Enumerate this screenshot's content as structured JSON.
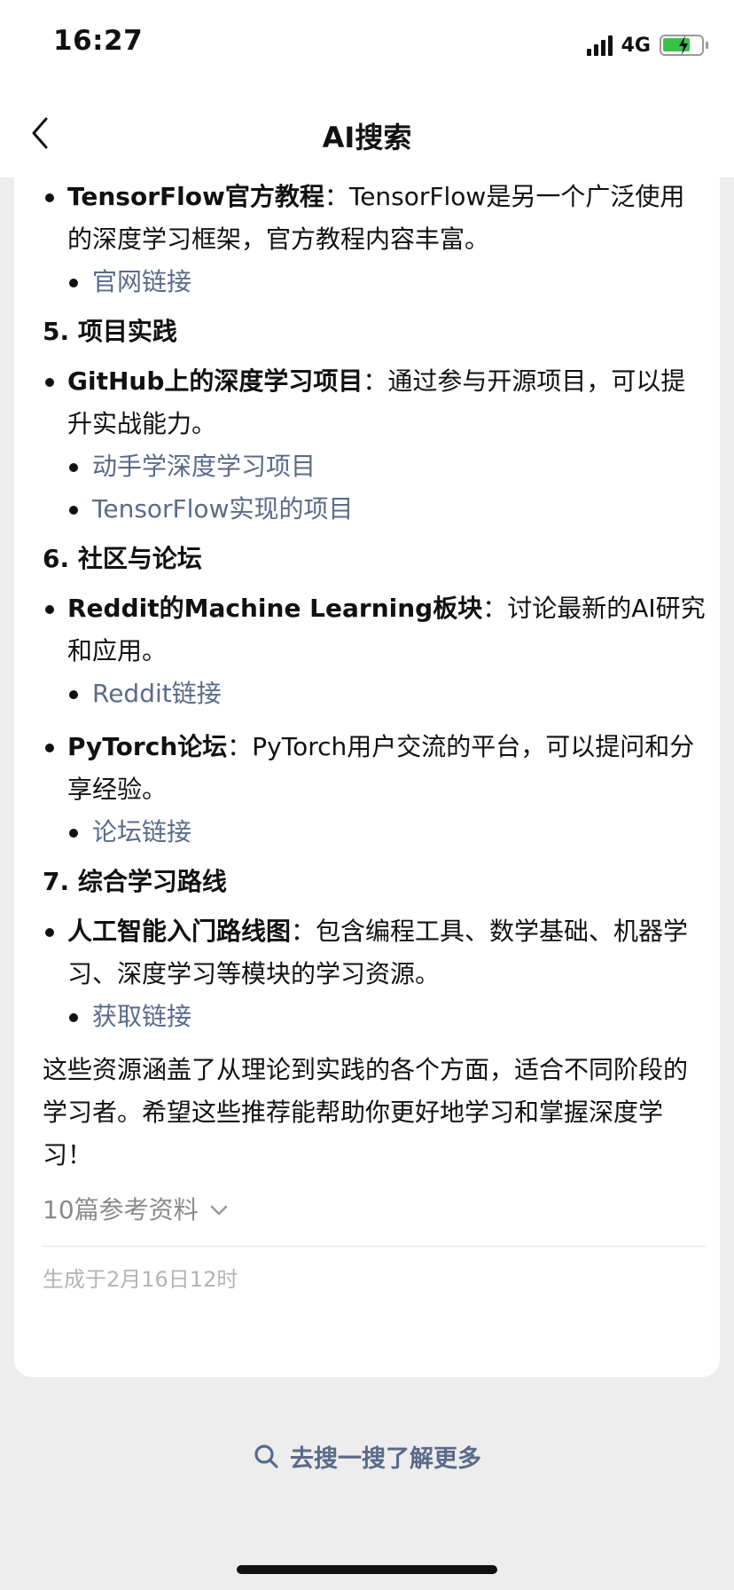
{
  "status_bar": {
    "time": "16:27",
    "network": "4G"
  },
  "nav": {
    "title": "AI搜索"
  },
  "content": {
    "item_tf": {
      "title": "TensorFlow官方教程",
      "desc": "：TensorFlow是另一个广泛使用的深度学习框架，官方教程内容丰富。",
      "links": [
        "官网链接"
      ]
    },
    "section5": "5. 项目实践",
    "item_github": {
      "title": "GitHub上的深度学习项目",
      "desc": "：通过参与开源项目，可以提升实战能力。",
      "links": [
        "动手学深度学习项目",
        "TensorFlow实现的项目"
      ]
    },
    "section6": "6. 社区与论坛",
    "item_reddit": {
      "title": "Reddit的Machine Learning板块",
      "desc": "：讨论最新的AI研究和应用。",
      "links": [
        "Reddit链接"
      ]
    },
    "item_pytorch": {
      "title": "PyTorch论坛",
      "desc": "：PyTorch用户交流的平台，可以提问和分享经验。",
      "links": [
        "论坛链接"
      ]
    },
    "section7": "7. 综合学习路线",
    "item_roadmap": {
      "title": "人工智能入门路线图",
      "desc": "：包含编程工具、数学基础、机器学习、深度学习等模块的学习资源。",
      "links": [
        "获取链接"
      ]
    },
    "summary": "这些资源涵盖了从理论到实践的各个方面，适合不同阶段的学习者。希望这些推荐能帮助你更好地学习和掌握深度学习！",
    "references": "10篇参考资料",
    "generated": "生成于2月16日12时"
  },
  "footer": {
    "search_more": "去搜一搜了解更多"
  },
  "colors": {
    "link": "#5a6b89",
    "background": "#ededed",
    "battery": "#39c24a"
  },
  "icons": [
    "back-arrow-icon",
    "signal-icon",
    "battery-icon",
    "chevron-down-icon",
    "search-icon"
  ]
}
